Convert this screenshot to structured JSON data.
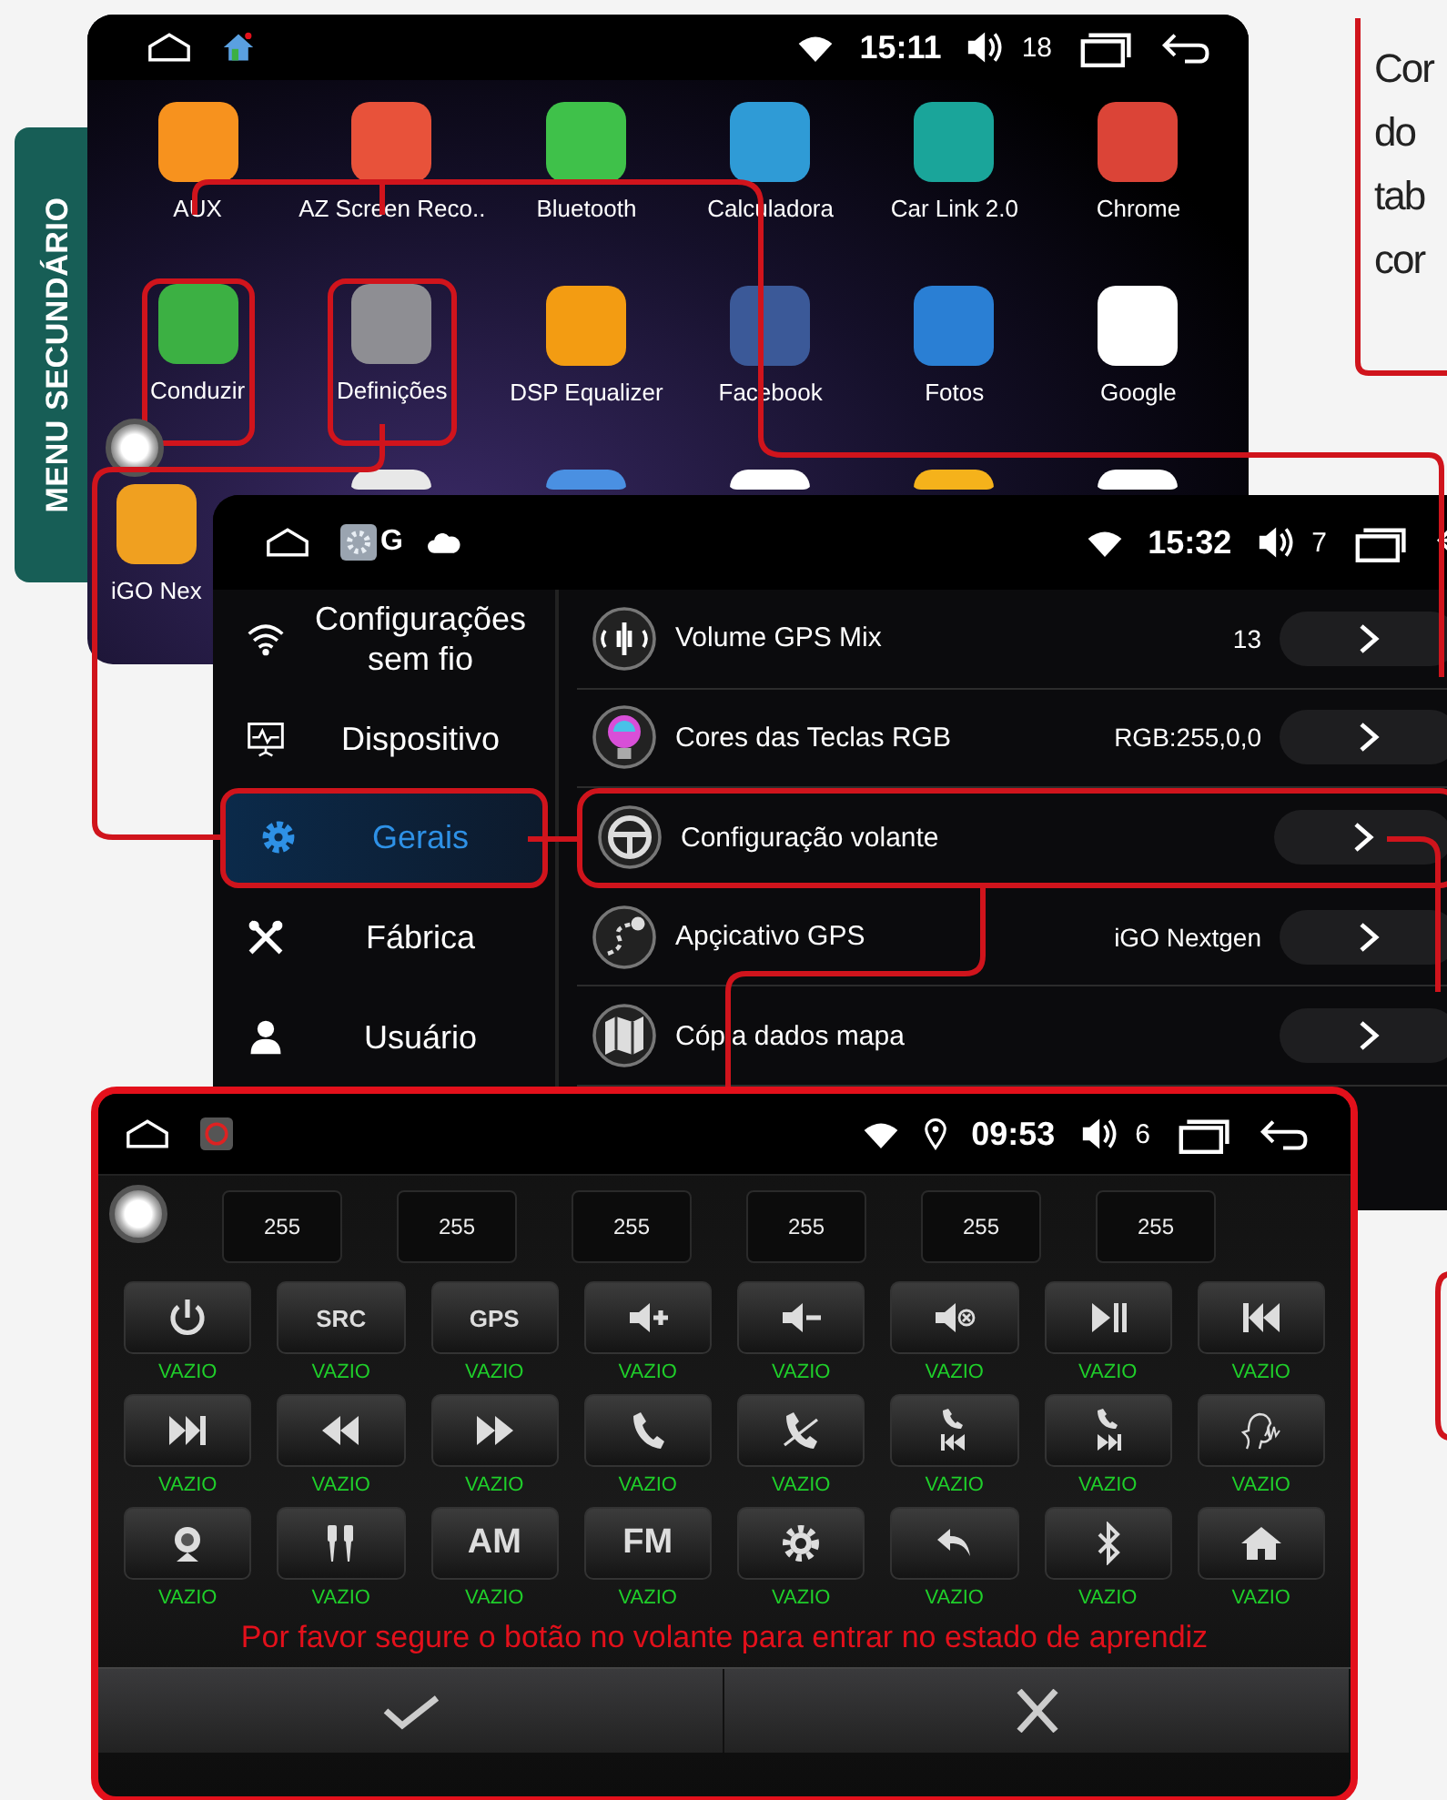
{
  "side_tab": {
    "label": "MENU SECUNDÁRIO"
  },
  "home_screen": {
    "status_bar": {
      "time": "15:11",
      "volume": "18"
    },
    "apps": [
      {
        "label": "AUX",
        "color": "#f7921e",
        "highlighted": false
      },
      {
        "label": "AZ Screen Reco..",
        "color": "#e8523a",
        "highlighted": false
      },
      {
        "label": "Bluetooth",
        "color": "#3fc14a",
        "highlighted": false
      },
      {
        "label": "Calculadora",
        "color": "#2f9bd6",
        "highlighted": false
      },
      {
        "label": "Car Link 2.0",
        "color": "#1aa59a",
        "highlighted": false
      },
      {
        "label": "Chrome",
        "color": "#db4437",
        "highlighted": false
      },
      {
        "label": "Conduzir",
        "color": "#3cb043",
        "highlighted": true
      },
      {
        "label": "Definições",
        "color": "#8e8e93",
        "highlighted": true
      },
      {
        "label": "DSP Equalizer",
        "color": "#f39c12",
        "highlighted": false
      },
      {
        "label": "Facebook",
        "color": "#3b5998",
        "highlighted": false
      },
      {
        "label": "Fotos",
        "color": "#2a7fd4",
        "highlighted": false
      },
      {
        "label": "Google",
        "color": "#ffffff",
        "highlighted": false
      },
      {
        "label": "iGO Nex",
        "color": "#f0a020",
        "highlighted": false
      },
      {
        "color": "#e8e8e8",
        "highlighted": false
      },
      {
        "color": "#4a90e2",
        "highlighted": false
      },
      {
        "color": "#ffffff",
        "highlighted": false
      },
      {
        "color": "#f5b21b",
        "highlighted": false
      },
      {
        "color": "#ffffff",
        "highlighted": false
      }
    ]
  },
  "settings_screen": {
    "status_bar": {
      "notification": "G",
      "time": "15:32",
      "volume": "7"
    },
    "sidebar": [
      {
        "label": "Configurações sem fio",
        "selected": false
      },
      {
        "label": "Dispositivo",
        "selected": false
      },
      {
        "label": "Gerais",
        "selected": true
      },
      {
        "label": "Fábrica",
        "selected": false
      },
      {
        "label": "Usuário",
        "selected": false
      }
    ],
    "rows": [
      {
        "label": "Volume GPS Mix",
        "value": "13",
        "highlighted": false
      },
      {
        "label": "Cores das Teclas RGB",
        "value": "RGB:255,0,0",
        "highlighted": false
      },
      {
        "label": "Configuração volante",
        "highlighted": true
      },
      {
        "label": "Apçicativo GPS",
        "value": "iGO Nextgen",
        "highlighted": false
      },
      {
        "label": "Cópia dados mapa",
        "highlighted": false
      }
    ]
  },
  "learning_screen": {
    "status_bar": {
      "time": "09:53",
      "volume": "6"
    },
    "code_fields": [
      "255",
      "255",
      "255",
      "255",
      "255",
      "255"
    ],
    "keys": [
      {
        "label": "VAZIO"
      },
      {
        "text": "SRC",
        "label": "VAZIO"
      },
      {
        "text": "GPS",
        "label": "VAZIO"
      },
      {
        "label": "VAZIO"
      },
      {
        "label": "VAZIO"
      },
      {
        "label": "VAZIO"
      },
      {
        "label": "VAZIO"
      },
      {
        "label": "VAZIO"
      },
      {
        "label": "VAZIO"
      },
      {
        "label": "VAZIO"
      },
      {
        "label": "VAZIO"
      },
      {
        "label": "VAZIO"
      },
      {
        "label": "VAZIO"
      },
      {
        "label": "VAZIO"
      },
      {
        "label": "VAZIO"
      },
      {
        "label": "VAZIO"
      },
      {
        "label": "VAZIO"
      },
      {
        "label": "VAZIO"
      },
      {
        "text": "AM",
        "label": "VAZIO"
      },
      {
        "text": "FM",
        "label": "VAZIO"
      },
      {
        "label": "VAZIO"
      },
      {
        "label": "VAZIO"
      },
      {
        "label": "VAZIO"
      },
      {
        "label": "VAZIO"
      }
    ],
    "message": "Por favor segure o botão no volante para entrar no estado de aprendiz"
  },
  "callout_text": [
    "Cor",
    "do",
    "tab",
    "cor"
  ]
}
